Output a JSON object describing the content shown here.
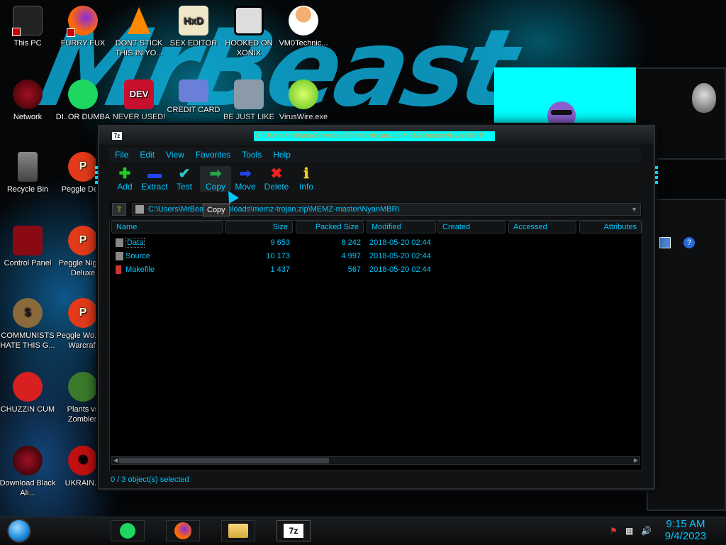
{
  "desktop": {
    "icons": [
      {
        "label": "This PC"
      },
      {
        "label": "FURRY FUX"
      },
      {
        "label": "DONT STICK THIS IN YO..."
      },
      {
        "label": "SEX EDITOR"
      },
      {
        "label": "HOOKED ON XONIX"
      },
      {
        "label": "VM0Technic..."
      },
      {
        "label": "Network"
      },
      {
        "label": "DI..OR DUMBA"
      },
      {
        "label": "NEVER USED!"
      },
      {
        "label": "CREDIT CARD"
      },
      {
        "label": "BE JUST LIKE"
      },
      {
        "label": "VirusWire.exe"
      },
      {
        "label": "Recycle Bin"
      },
      {
        "label": "Peggle De..."
      },
      {
        "label": "Control Panel"
      },
      {
        "label": "Peggle Nights Deluxe"
      },
      {
        "label": "COMMUNISTS HATE THIS G..."
      },
      {
        "label": "Peggle Wo... of Warcraft"
      },
      {
        "label": "CHUZZIN CUM"
      },
      {
        "label": "Plants vs Zombies"
      },
      {
        "label": "Download Black Ali..."
      },
      {
        "label": "UKRAIN..."
      }
    ],
    "wallpaper_text": "MrBeast"
  },
  "window": {
    "title": "C:\\Users\\MrBeast\\Downloads\\memz-trojan.zip\\MEMZ-master\\NyanMBR\\",
    "app_icon": "7z",
    "menu": [
      "File",
      "Edit",
      "View",
      "Favorites",
      "Tools",
      "Help"
    ],
    "toolbar": [
      {
        "label": "Add",
        "icon": "plus-icon",
        "color": "#22cc22"
      },
      {
        "label": "Extract",
        "icon": "minus-icon",
        "color": "#2244ee"
      },
      {
        "label": "Test",
        "icon": "check-icon",
        "color": "#22cccc"
      },
      {
        "label": "Copy",
        "icon": "arrow-right-icon",
        "color": "#22aa44"
      },
      {
        "label": "Move",
        "icon": "arrow-right-icon",
        "color": "#2244ee"
      },
      {
        "label": "Delete",
        "icon": "x-icon",
        "color": "#ee2222"
      },
      {
        "label": "Info",
        "icon": "info-icon",
        "color": "#eecc22"
      }
    ],
    "tooltip": "Copy",
    "address": "C:\\Users\\MrBeast\\Downloads\\memz-trojan.zip\\MEMZ-master\\NyanMBR\\",
    "columns": [
      "Name",
      "Size",
      "Packed Size",
      "Modified",
      "Created",
      "Accessed",
      "Attributes"
    ],
    "rows": [
      {
        "name": "Data",
        "size": "9 653",
        "packed": "8 242",
        "modified": "2018-05-20 02:44",
        "type": "folder"
      },
      {
        "name": "Source",
        "size": "10 173",
        "packed": "4 997",
        "modified": "2018-05-20 02:44",
        "type": "folder"
      },
      {
        "name": "Makefile",
        "size": "1 437",
        "packed": "567",
        "modified": "2018-05-20 02:44",
        "type": "file"
      }
    ],
    "status": "0 / 3 object(s) selected"
  },
  "taskbar": {
    "time": "9:15 AM",
    "date": "9/4/2023",
    "buttons": [
      "spotify-icon",
      "firefox-icon",
      "file-explorer-icon",
      "7zip-icon"
    ],
    "zip_label": "7z"
  }
}
